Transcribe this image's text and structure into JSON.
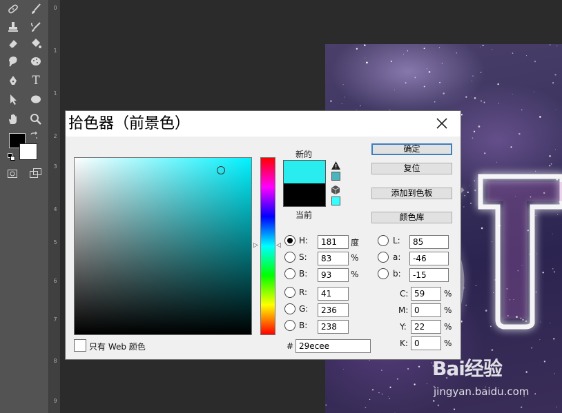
{
  "dialog": {
    "title": "拾色器（前景色）",
    "new_label": "新的",
    "current_label": "当前",
    "buttons": {
      "ok": "确定",
      "reset": "复位",
      "add_to_swatches": "添加到色板",
      "color_libraries": "颜色库"
    },
    "hsb": {
      "h": {
        "label": "H:",
        "value": "181",
        "unit": "度",
        "selected": true
      },
      "s": {
        "label": "S:",
        "value": "83",
        "unit": "%"
      },
      "b": {
        "label": "B:",
        "value": "93",
        "unit": "%"
      }
    },
    "rgb": {
      "r": {
        "label": "R:",
        "value": "41"
      },
      "g": {
        "label": "G:",
        "value": "236"
      },
      "b": {
        "label": "B:",
        "value": "238"
      }
    },
    "lab": {
      "l": {
        "label": "L:",
        "value": "85"
      },
      "a": {
        "label": "a:",
        "value": "-46"
      },
      "b": {
        "label": "b:",
        "value": "-15"
      }
    },
    "cmyk": {
      "c": {
        "label": "C:",
        "value": "59",
        "unit": "%"
      },
      "m": {
        "label": "M:",
        "value": "0",
        "unit": "%"
      },
      "y": {
        "label": "Y:",
        "value": "22",
        "unit": "%"
      },
      "k": {
        "label": "K:",
        "value": "0",
        "unit": "%"
      }
    },
    "hex_label": "#",
    "hex_value": "29ecee",
    "web_only_label": "只有 Web 颜色",
    "new_color": "#29ecee",
    "current_color": "#000000"
  },
  "ruler": {
    "numbers": [
      "0",
      "1",
      "2",
      "3",
      "4",
      "5",
      "6",
      "7",
      "8",
      "9"
    ]
  },
  "toolbox": {
    "tools": [
      "healing-brush-icon",
      "brush-icon",
      "clone-stamp-icon",
      "history-brush-icon",
      "eraser-icon",
      "paint-bucket-icon",
      "smudge-icon",
      "sponge-icon",
      "pen-icon",
      "type-icon",
      "path-selection-icon",
      "ellipse-icon",
      "hand-icon",
      "zoom-icon"
    ],
    "type_glyph": "T",
    "foreground_color": "#000000",
    "background_color": "#ffffff"
  },
  "watermark": {
    "logo": "Bai经验",
    "url": "jingyan.baidu.com"
  }
}
